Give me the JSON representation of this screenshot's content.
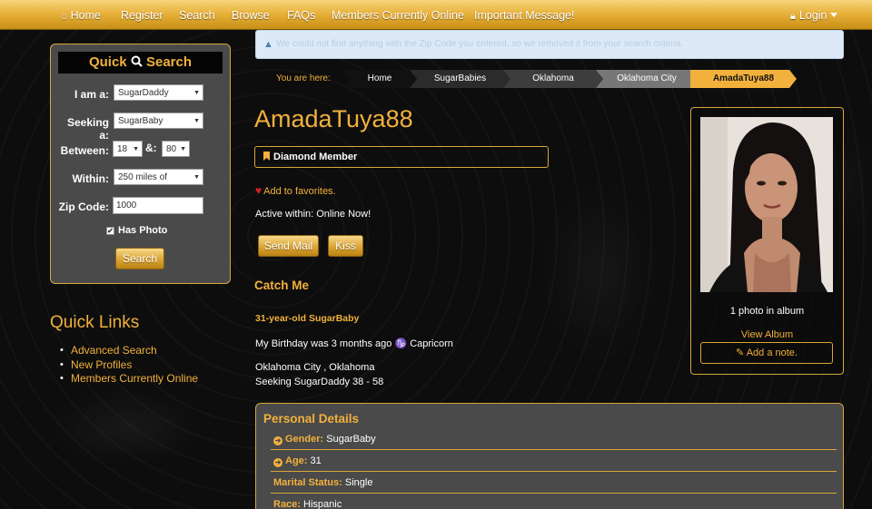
{
  "nav": {
    "home": "Home",
    "register": "Register",
    "search": "Search",
    "browse": "Browse",
    "faqs": "FAQs",
    "members_online": "Members Currently Online",
    "important": "Important Message!",
    "login": "Login"
  },
  "quick_search": {
    "title": "Quick",
    "title2": "Search",
    "i_am_label": "I am a:",
    "i_am_value": "SugarDaddy",
    "seeking_label": "Seeking a:",
    "seeking_value": "SugarBaby",
    "between_label": "Between:",
    "age_min": "18",
    "and_label": "&:",
    "age_max": "80",
    "within_label": "Within:",
    "within_value": "250 miles of",
    "zip_label": "Zip Code:",
    "zip_value": "1000",
    "has_photo_label": "Has Photo",
    "has_photo_checked": true,
    "search_button": "Search"
  },
  "quick_links": {
    "title": "Quick Links",
    "items": [
      "Advanced Search",
      "New Profiles",
      "Members Currently Online"
    ]
  },
  "alert": {
    "text": "We could not find anything with the Zip Code you entered, so we removed it from your search criteria."
  },
  "breadcrumb": {
    "label": "You are here:",
    "items": [
      "Home",
      "SugarBabies",
      "Oklahoma",
      "Oklahoma City",
      "AmadaTuya88"
    ]
  },
  "profile": {
    "username": "AmadaTuya88",
    "membership": "Diamond Member",
    "favorites": "Add to favorites.",
    "active": "Active within: Online Now!",
    "send_mail": "Send Mail",
    "kiss": "Kiss",
    "catch_title": "Catch Me",
    "age_line": "31-year-old SugarBaby",
    "birthday": "My Birthday was 3 months ago ♑ Capricorn",
    "location": "Oklahoma City , Oklahoma",
    "seeking": "Seeking SugarDaddy 38 - 58"
  },
  "photo_card": {
    "count": "1 photo in album",
    "view_album": "View Album",
    "add_note": "Add a note."
  },
  "personal_details": {
    "title": "Personal Details",
    "rows": [
      {
        "key": "Gender:",
        "value": "SugarBaby",
        "icon": true
      },
      {
        "key": "Age:",
        "value": "31",
        "icon": true
      },
      {
        "key": "Marital Status:",
        "value": "Single",
        "icon": false
      },
      {
        "key": "Race:",
        "value": "Hispanic",
        "icon": false
      }
    ]
  },
  "colors": {
    "gold": "#f2b13c",
    "panel": "#4a4a4a",
    "background": "#0d0d0d"
  }
}
